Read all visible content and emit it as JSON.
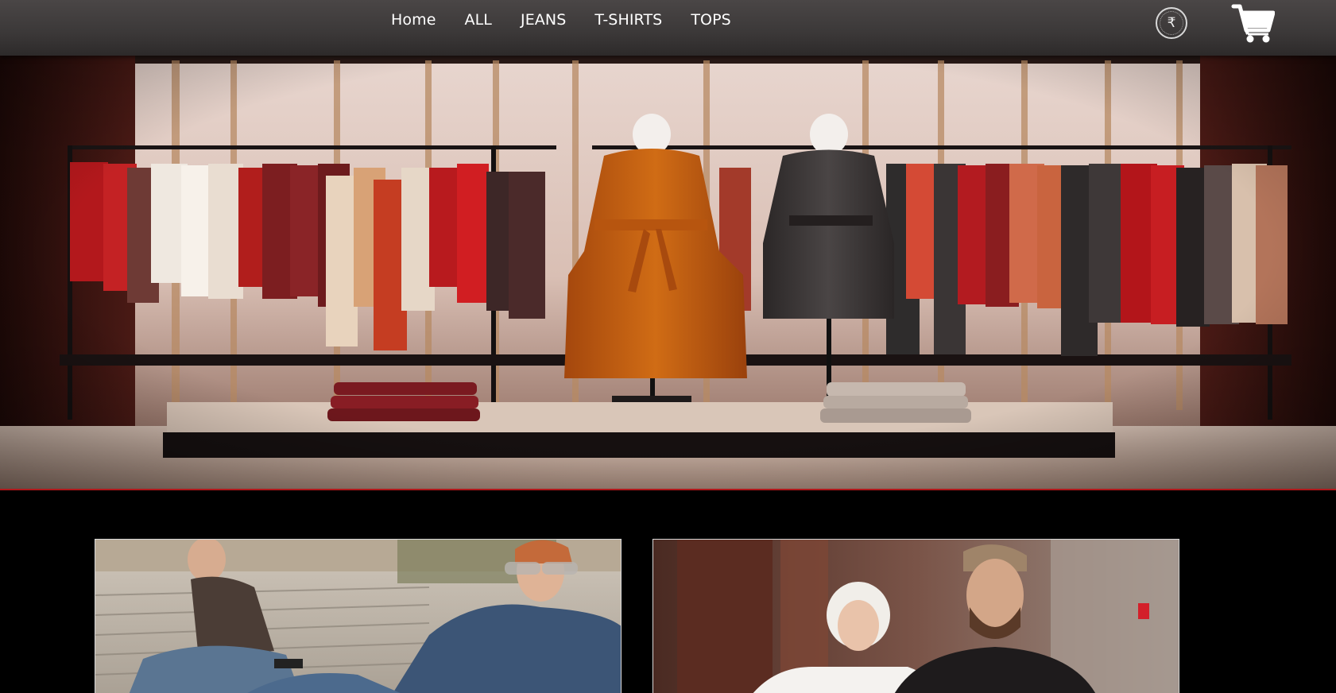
{
  "nav": {
    "items": [
      {
        "label": "Home"
      },
      {
        "label": "ALL"
      },
      {
        "label": "JEANS"
      },
      {
        "label": "T-SHIRTS"
      },
      {
        "label": "TOPS"
      }
    ],
    "currency_symbol": "₹"
  },
  "icons": {
    "currency": "rupee-icon",
    "cart": "shopping-cart-icon"
  },
  "colors": {
    "nav_background": "#3b3838",
    "page_background": "#000000",
    "hero_border": "#b0171a",
    "card_border": "#d9d9d9",
    "nav_text": "#ffffff"
  }
}
